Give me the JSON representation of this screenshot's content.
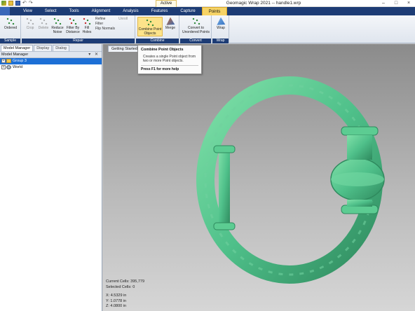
{
  "titlebar": {
    "window_title": "Geomagic Wrap 2021 -- handle1.wrp",
    "active_context": "Active"
  },
  "tabs": [
    "",
    "View",
    "Select",
    "Tools",
    "Alignment",
    "Analysis",
    "Features",
    "Capture",
    "Points"
  ],
  "ribbon": {
    "groups": {
      "sample": "Sample",
      "repair": "Repair",
      "combine": "Combine",
      "convert": "Convert",
      "wrap": "Wrap"
    },
    "buttons": {
      "ordered": "Ordered",
      "crop": "Crop",
      "delete": "Delete",
      "reduce_noise": "Reduce Noise",
      "filter_by_distance": "Filter By Distance",
      "fill_holes": "Fill Holes",
      "refine": "Refine",
      "filter": "Filter",
      "flip_normals": "Flip Normals",
      "unroll": "Unroll",
      "combine_point_objects": "Combine Point Objects",
      "merge": "Merge",
      "convert_unordered": "Convert to Unordered Points",
      "wrap": "Wrap"
    }
  },
  "left_panel": {
    "tabs": [
      "Model Manager",
      "Display",
      "Dialog"
    ],
    "header": "Model Manager",
    "tree": [
      {
        "label": "Group 3",
        "selected": true,
        "icon": "folder-icon"
      },
      {
        "label": "World",
        "selected": false,
        "icon": "globe-icon"
      }
    ]
  },
  "viewport": {
    "doc_tab": "Getting Started",
    "current_cells": "Current Cells: 395,779",
    "selected_cells": "Selected Cells: 0",
    "x": "X:  4.5329 in",
    "y": "Y:  1.0778 in",
    "z": "Z:  4.0800 in"
  },
  "tooltip": {
    "title": "Combine Point Objects",
    "description": "Creates a single Point object from two or more Point objects.",
    "help": "Press F1 for more help"
  },
  "colors": {
    "ribbon_dark": "#1d3c75",
    "active_tab": "#f6d365",
    "selection": "#1c6fd6",
    "model_green": "#4fc08a"
  }
}
